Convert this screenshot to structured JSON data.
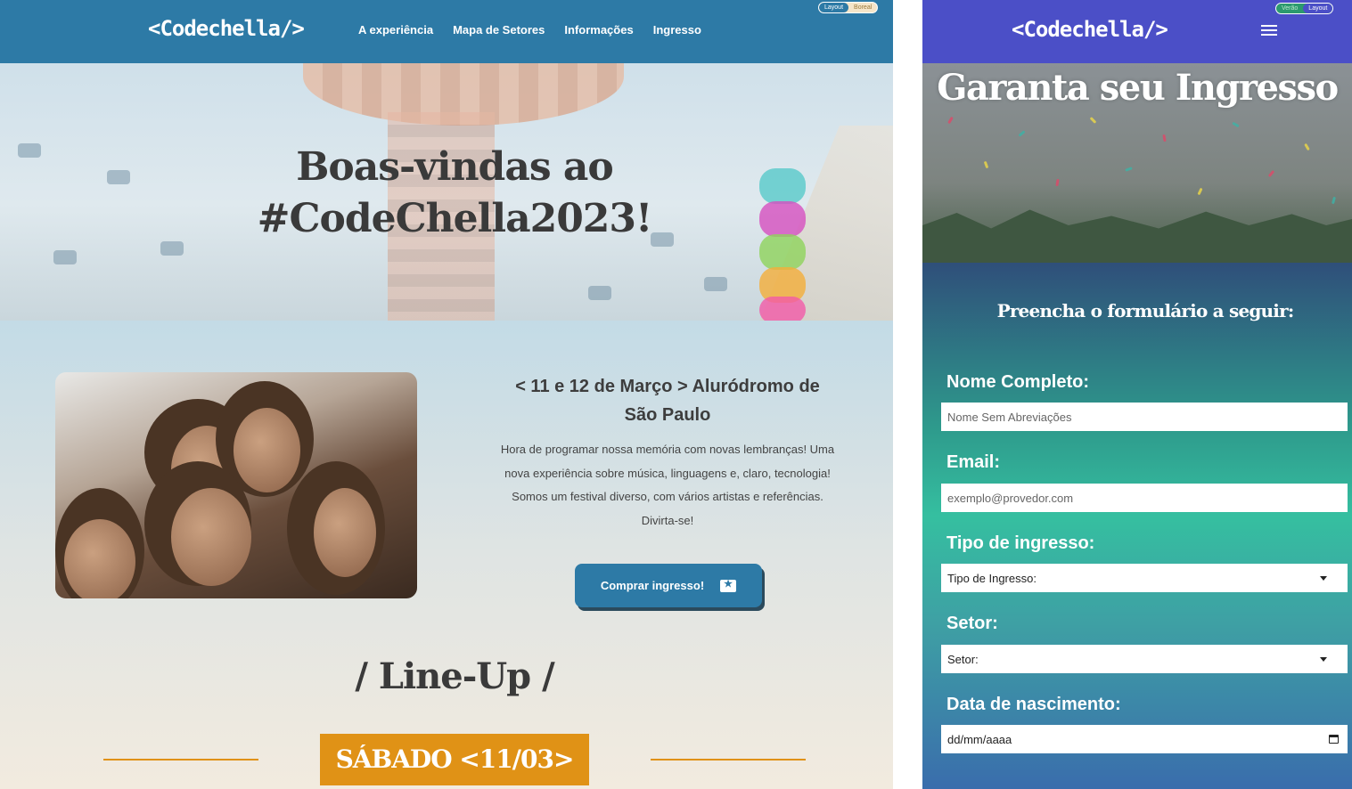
{
  "desktop": {
    "logo": "<Codechella/>",
    "nav": [
      "A experiência",
      "Mapa de Setores",
      "Informações",
      "Ingresso"
    ],
    "theme_toggle": {
      "active": "Layout",
      "inactive": "Boreal"
    },
    "hero_title": "Boas-vindas ao #CodeChella2023!",
    "event_title": "< 11 e 12 de Março > Aluródromo de São Paulo",
    "event_description": "Hora de programar nossa memória com novas lembranças! Uma nova experiência sobre música, linguagens e, claro, tecnologia! Somos um festival diverso, com vários artistas e referências. Divirta-se!",
    "buy_button": "Comprar ingresso!",
    "lineup_title": "/ Line-Up /",
    "day_badge": "SÁBADO <11/03>",
    "colors": {
      "header": "#2d7aa6",
      "accent": "#e09216"
    }
  },
  "mobile": {
    "logo": "<Codechella/>",
    "theme_toggle": {
      "inactive": "Verão",
      "active": "Layout"
    },
    "hero_title": "Garanta seu Ingresso",
    "form_heading": "Preencha o formulário a seguir:",
    "fields": {
      "name": {
        "label": "Nome Completo:",
        "placeholder": "Nome Sem Abreviações"
      },
      "email": {
        "label": "Email:",
        "placeholder": "exemplo@provedor.com"
      },
      "ticket_type": {
        "label": "Tipo de ingresso:",
        "value": "Tipo de Ingresso:"
      },
      "sector": {
        "label": "Setor:",
        "value": "Setor:"
      },
      "birthdate": {
        "label": "Data de nascimento:",
        "value": "dd/mm/aaaa"
      }
    },
    "colors": {
      "header": "#4b4fc7"
    }
  }
}
